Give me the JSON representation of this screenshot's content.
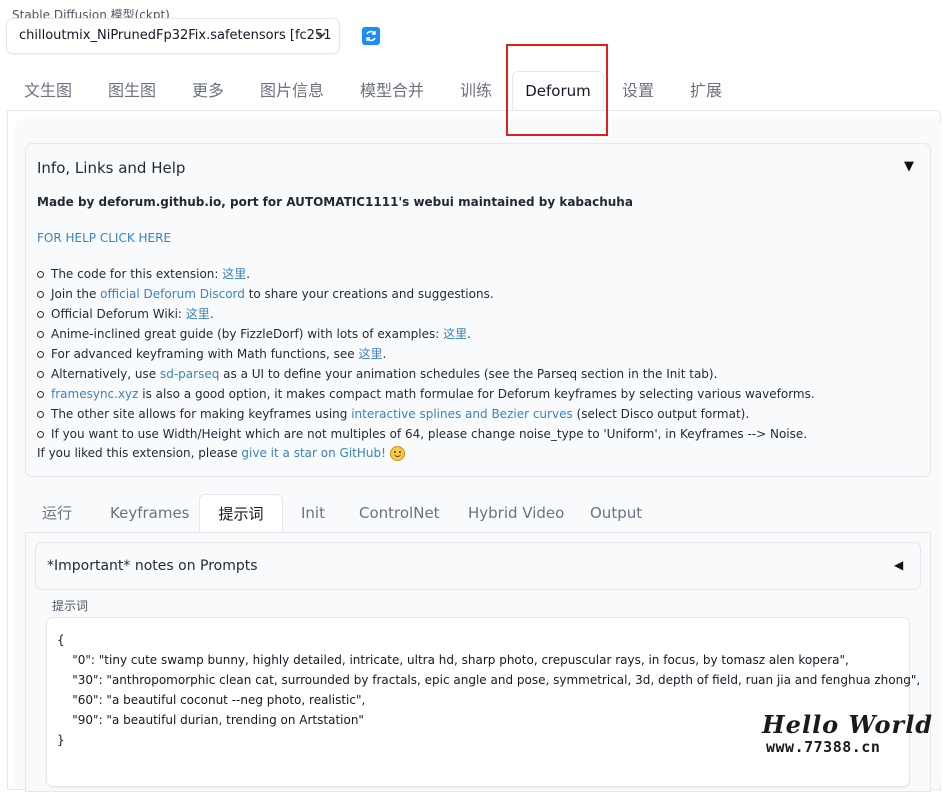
{
  "model": {
    "label": "Stable Diffusion 模型(ckpt)",
    "selected": "chilloutmix_NiPrunedFp32Fix.safetensors [fc251"
  },
  "top_tabs": [
    {
      "label": "文生图"
    },
    {
      "label": "图生图"
    },
    {
      "label": "更多"
    },
    {
      "label": "图片信息"
    },
    {
      "label": "模型合并"
    },
    {
      "label": "训练"
    },
    {
      "label": "Deforum",
      "active": true
    },
    {
      "label": "设置"
    },
    {
      "label": "扩展"
    }
  ],
  "info": {
    "title": "Info, Links and Help",
    "arrow": "▼",
    "made_by": "Made by deforum.github.io, port for AUTOMATIC1111's webui maintained by kabachuha",
    "help_link": "FOR HELP CLICK HERE",
    "bullets": [
      {
        "pre": "The code for this extension: ",
        "link": "这里",
        "post": "."
      },
      {
        "pre": "Join the ",
        "link": "official Deforum Discord",
        "post": " to share your creations and suggestions."
      },
      {
        "pre": "Official Deforum Wiki: ",
        "link": "这里",
        "post": "."
      },
      {
        "pre": "Anime-inclined great guide (by FizzleDorf) with lots of examples: ",
        "link": "这里",
        "post": "."
      },
      {
        "pre": "For advanced keyframing with Math functions, see ",
        "link": "这里",
        "post": "."
      },
      {
        "pre": "Alternatively, use ",
        "link": "sd-parseq",
        "post": " as a UI to define your animation schedules (see the Parseq section in the Init tab)."
      },
      {
        "pre": "",
        "link": "framesync.xyz",
        "post": " is also a good option, it makes compact math formulae for Deforum keyframes by selecting various waveforms."
      },
      {
        "pre": "The other site allows for making keyframes using ",
        "link": "interactive splines and Bezier curves",
        "post": " (select Disco output format)."
      },
      {
        "pre": "If you want to use Width/Height which are not multiples of 64, please change noise_type to 'Uniform', in Keyframes --> Noise.",
        "link": "",
        "post": ""
      }
    ],
    "liked_pre": "If you liked this extension, please ",
    "liked_link": "give it a star on GitHub!"
  },
  "sub_tabs": [
    {
      "label": "运行"
    },
    {
      "label": "Keyframes"
    },
    {
      "label": "提示词",
      "active": true
    },
    {
      "label": "Init"
    },
    {
      "label": "ControlNet"
    },
    {
      "label": "Hybrid Video"
    },
    {
      "label": "Output"
    }
  ],
  "notes": {
    "title": "*Important* notes on Prompts",
    "arrow": "◀"
  },
  "prompts": {
    "label": "提示词",
    "lines": [
      "{",
      "    \"0\": \"tiny cute swamp bunny, highly detailed, intricate, ultra hd, sharp photo, crepuscular rays, in focus, by tomasz alen kopera\",",
      "    \"30\": \"anthropomorphic clean cat, surrounded by fractals, epic angle and pose, symmetrical, 3d, depth of field, ruan jia and fenghua zhong\",",
      "    \"60\": \"a beautiful coconut --neg photo, realistic\",",
      "    \"90\": \"a beautiful durian, trending on Artstation\"",
      "}"
    ]
  },
  "watermark": {
    "line1": "Hello World",
    "line2": "www.77388.cn"
  },
  "colors": {
    "link": "#3b82c4",
    "highlight": "#e11d1d",
    "refresh": "#1f8df0"
  }
}
